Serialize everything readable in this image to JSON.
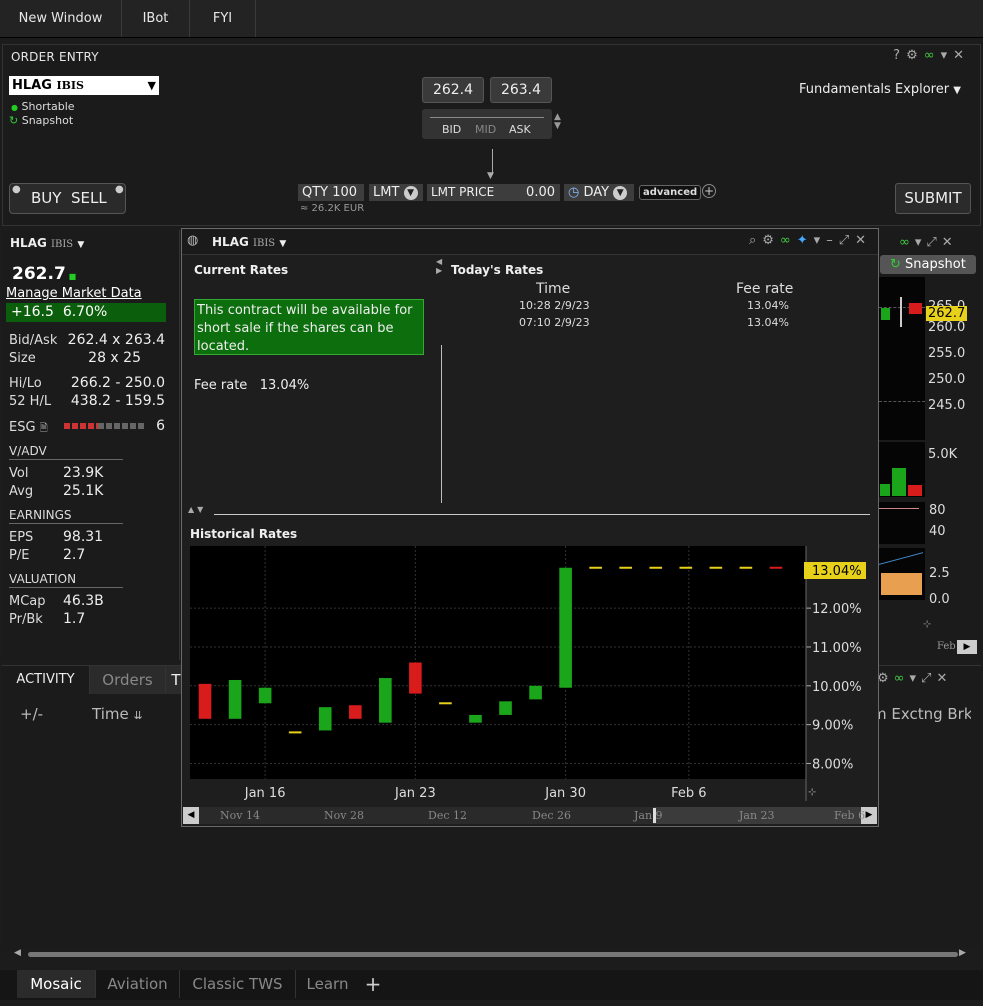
{
  "topbar": {
    "items": [
      "New Window",
      "IBot",
      "FYI"
    ]
  },
  "order_entry": {
    "title": "ORDER ENTRY",
    "symbol": "HLAG",
    "exchange": "IBIS",
    "shortable": "Shortable",
    "snapshot": "Snapshot",
    "bid_price": "262.4",
    "ask_price": "263.4",
    "bid_label": "BID",
    "mid_label": "MID",
    "ask_label": "ASK",
    "fundamentals": "Fundamentals Explorer",
    "buy_label": "BUY",
    "sell_label": "SELL",
    "qty": "QTY 100",
    "qty_note": "≈ 26.2K EUR",
    "order_type": "LMT",
    "lmt_price_label": "LMT PRICE",
    "lmt_price": "0.00",
    "tif": "DAY",
    "advanced": "advanced",
    "submit": "SUBMIT"
  },
  "quote": {
    "symbol": "HLAG",
    "exchange": "IBIS",
    "last": "262.7",
    "manage": "Manage Market Data",
    "change": "+16.5",
    "change_pct": "6.70%",
    "bidask_label": "Bid/Ask",
    "bidask": "262.4 x 263.4",
    "size_label": "Size",
    "size": "28 x 25",
    "hilo_label": "Hi/Lo",
    "hilo": "266.2 - 250.0",
    "h52_label": "52 H/L",
    "h52": "438.2 - 159.5",
    "esg_label": "ESG",
    "esg_value": "6",
    "vadv_label": "V/ADV",
    "vol_label": "Vol",
    "vol": "23.9K",
    "avg_label": "Avg",
    "avg": "25.1K",
    "earnings_label": "EARNINGS",
    "eps_label": "EPS",
    "eps": "98.31",
    "pe_label": "P/E",
    "pe": "2.7",
    "valuation_label": "VALUATION",
    "mcap_label": "MCap",
    "mcap": "46.3B",
    "prbk_label": "Pr/Bk",
    "prbk": "1.7"
  },
  "activity": {
    "tabs": [
      "ACTIVITY",
      "Orders",
      "T"
    ],
    "plusminus": "+/-",
    "time_col": "Time",
    "right_cols": "m Exctng Brk"
  },
  "popup": {
    "symbol": "HLAG",
    "exchange": "IBIS",
    "current_rates": "Current Rates",
    "todays_rates": "Today's Rates",
    "availability": "This contract will be available for short sale if the shares can be located.",
    "fee_label": "Fee rate",
    "fee_value": "13.04%",
    "table_headers": [
      "Time",
      "Fee rate"
    ],
    "table_rows": [
      {
        "time": "10:28  2/9/23",
        "fee": "13.04%"
      },
      {
        "time": "07:10  2/9/23",
        "fee": "13.04%"
      }
    ],
    "historical_rates": "Historical Rates",
    "current_label": "13.04%",
    "nav_labels": [
      "Nov 14",
      "Nov 28",
      "Dec 12",
      "Dec 26",
      "Jan 9",
      "Jan 23",
      "Feb 6"
    ]
  },
  "side_chart": {
    "snapshot": "Snapshot",
    "price_ticks": [
      "265.0",
      "260.0",
      "255.0",
      "250.0",
      "245.0"
    ],
    "last": "262.7",
    "volume_tick": "5.0K",
    "ind1_ticks": [
      "80",
      "40"
    ],
    "ind2_ticks": [
      "2.5",
      "0.0"
    ],
    "date_label": "Feb"
  },
  "chart_data": {
    "type": "candlestick",
    "title": "Historical Rates",
    "x_tick_labels": [
      "Jan 16",
      "Jan 23",
      "Jan 30",
      "Feb 6"
    ],
    "y_tick_labels": [
      "8.00%",
      "9.00%",
      "10.00%",
      "11.00%",
      "12.00%"
    ],
    "ylim": [
      7.6,
      13.6
    ],
    "grid": true,
    "candles": [
      {
        "open": 10.05,
        "close": 9.15,
        "color": "red"
      },
      {
        "open": 9.15,
        "close": 10.15,
        "color": "green"
      },
      {
        "open": 9.55,
        "close": 9.95,
        "color": "green"
      },
      {
        "open": 8.8,
        "close": 8.8,
        "color": "flat"
      },
      {
        "open": 8.85,
        "close": 9.45,
        "color": "green"
      },
      {
        "open": 9.5,
        "close": 9.15,
        "color": "red"
      },
      {
        "open": 9.05,
        "close": 10.2,
        "color": "green"
      },
      {
        "open": 10.6,
        "close": 9.8,
        "color": "red"
      },
      {
        "open": 9.55,
        "close": 9.55,
        "color": "flat"
      },
      {
        "open": 9.05,
        "close": 9.25,
        "color": "green"
      },
      {
        "open": 9.25,
        "close": 9.6,
        "color": "green"
      },
      {
        "open": 9.65,
        "close": 10.0,
        "color": "green"
      },
      {
        "open": 9.95,
        "close": 13.04,
        "color": "green"
      },
      {
        "open": 13.04,
        "close": 13.04,
        "color": "flat"
      },
      {
        "open": 13.04,
        "close": 13.04,
        "color": "flat"
      },
      {
        "open": 13.04,
        "close": 13.04,
        "color": "flat"
      },
      {
        "open": 13.04,
        "close": 13.04,
        "color": "flat"
      },
      {
        "open": 13.04,
        "close": 13.04,
        "color": "flat"
      },
      {
        "open": 13.04,
        "close": 13.04,
        "color": "flat"
      },
      {
        "open": 13.04,
        "close": 13.04,
        "color": "flat-red"
      }
    ]
  },
  "bottom_tabs": [
    "Mosaic",
    "Aviation",
    "Classic TWS",
    "Learn"
  ],
  "colors": {
    "green": "#1aa51a",
    "red": "#d81c1c",
    "yellow": "#e8d11a",
    "accent_green": "#0f6b0f"
  }
}
